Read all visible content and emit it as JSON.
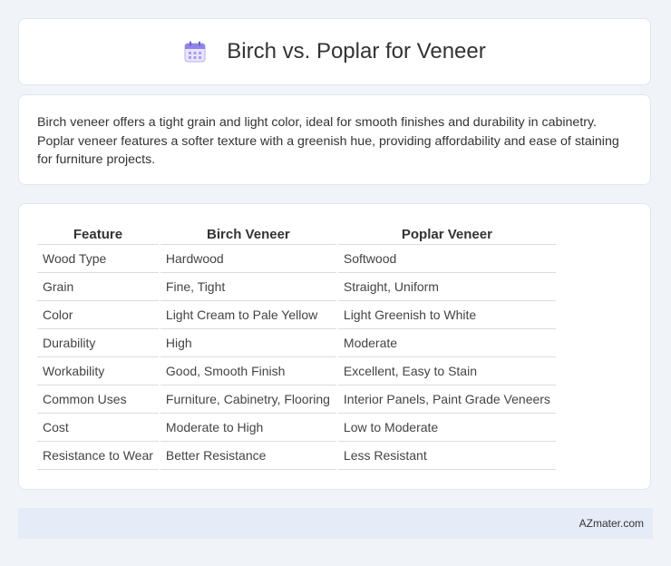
{
  "header": {
    "icon": "calendar-icon",
    "title": "Birch vs. Poplar for Veneer"
  },
  "summary": {
    "text": "Birch veneer offers a tight grain and light color, ideal for smooth finishes and durability in cabinetry. Poplar veneer features a softer texture with a greenish hue, providing affordability and ease of staining for furniture projects."
  },
  "table": {
    "headers": [
      "Feature",
      "Birch Veneer",
      "Poplar Veneer"
    ],
    "rows": [
      [
        "Wood Type",
        "Hardwood",
        "Softwood"
      ],
      [
        "Grain",
        "Fine, Tight",
        "Straight, Uniform"
      ],
      [
        "Color",
        "Light Cream to Pale Yellow",
        "Light Greenish to White"
      ],
      [
        "Durability",
        "High",
        "Moderate"
      ],
      [
        "Workability",
        "Good, Smooth Finish",
        "Excellent, Easy to Stain"
      ],
      [
        "Common Uses",
        "Furniture, Cabinetry, Flooring",
        "Interior Panels, Paint Grade Veneers"
      ],
      [
        "Cost",
        "Moderate to High",
        "Low to Moderate"
      ],
      [
        "Resistance to Wear",
        "Better Resistance",
        "Less Resistant"
      ]
    ]
  },
  "footer": {
    "site": "AZmater.com"
  }
}
